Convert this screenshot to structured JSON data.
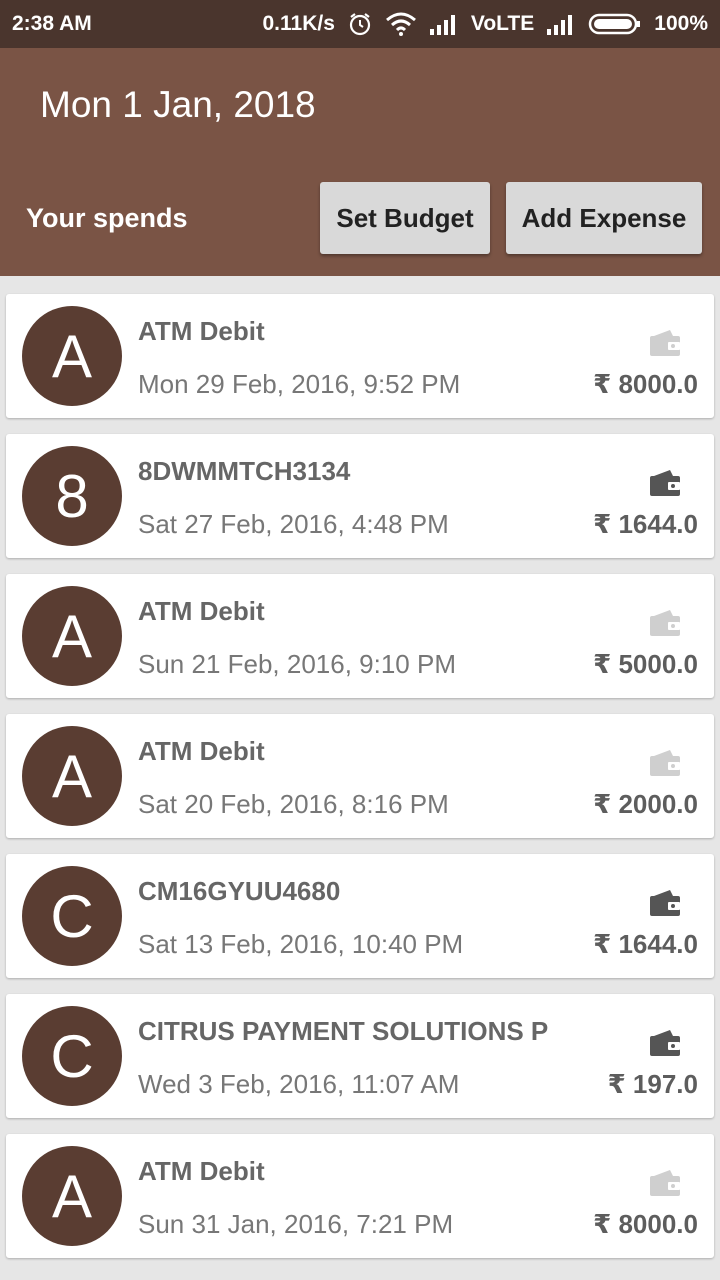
{
  "status_bar": {
    "time": "2:38 AM",
    "speed": "0.11K/s",
    "network": "VoLTE",
    "battery": "100%"
  },
  "header": {
    "date": "Mon 1 Jan, 2018",
    "subtitle": "Your spends",
    "set_budget_label": "Set Budget",
    "add_expense_label": "Add Expense"
  },
  "colors": {
    "status_bar": "#4a352d",
    "header": "#7a5445",
    "avatar": "#5a3d32",
    "wallet_light": "#cfcfcf",
    "wallet_dark": "#555555"
  },
  "expenses": [
    {
      "initial": "A",
      "title": "ATM Debit",
      "datetime": "Mon 29 Feb, 2016, 9:52 PM",
      "amount": "₹ 8000.0",
      "wallet_style": "light"
    },
    {
      "initial": "8",
      "title": "8DWMMTCH3134",
      "datetime": "Sat 27 Feb, 2016, 4:48 PM",
      "amount": "₹ 1644.0",
      "wallet_style": "dark"
    },
    {
      "initial": "A",
      "title": "ATM Debit",
      "datetime": "Sun 21 Feb, 2016, 9:10 PM",
      "amount": "₹ 5000.0",
      "wallet_style": "light"
    },
    {
      "initial": "A",
      "title": "ATM Debit",
      "datetime": "Sat 20 Feb, 2016, 8:16 PM",
      "amount": "₹ 2000.0",
      "wallet_style": "light"
    },
    {
      "initial": "C",
      "title": "CM16GYUU4680",
      "datetime": "Sat 13 Feb, 2016, 10:40 PM",
      "amount": "₹ 1644.0",
      "wallet_style": "dark"
    },
    {
      "initial": "C",
      "title": "CITRUS PAYMENT SOLUTIONS P",
      "datetime": "Wed 3 Feb, 2016, 11:07 AM",
      "amount": "₹ 197.0",
      "wallet_style": "dark"
    },
    {
      "initial": "A",
      "title": "ATM Debit",
      "datetime": "Sun 31 Jan, 2016, 7:21 PM",
      "amount": "₹ 8000.0",
      "wallet_style": "light"
    }
  ]
}
